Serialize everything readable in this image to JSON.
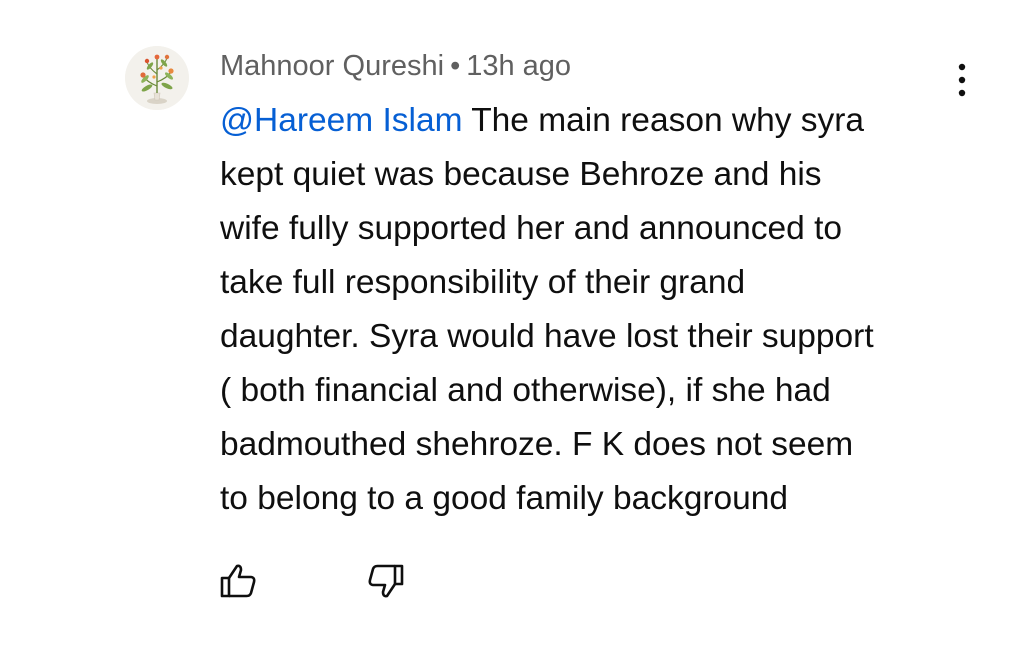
{
  "comment": {
    "author": "Mahnoor Qureshi",
    "separator": "•",
    "time": "13h ago",
    "mention": "@Hareem Islam",
    "text": "  The main reason why syra\nkept quiet was because Behroze  and his\nwife fully supported her and announced to\ntake full responsibility of their grand\ndaughter.  Syra would have lost their support\n( both financial and otherwise), if she had\nbadmouthed shehroze. F K does not seem\nto belong to a good family background"
  },
  "icons": {
    "avatar": "plant-flower-avatar",
    "more": "more-vert-icon",
    "like": "thumb-up-icon",
    "dislike": "thumb-down-icon"
  },
  "colors": {
    "mention": "#065fd4",
    "meta_text": "#606060",
    "body_text": "#0f0f0f",
    "icon": "#0f0f0f"
  }
}
